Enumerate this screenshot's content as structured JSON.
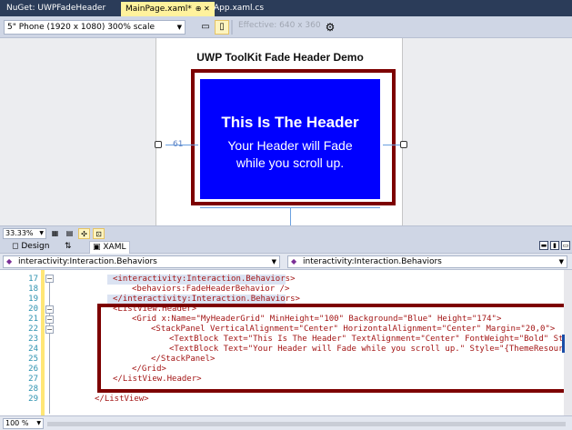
{
  "tabs": [
    {
      "label": "NuGet: UWPFadeHeader"
    },
    {
      "label": "MainPage.xaml*",
      "icons": "⊕ ✕"
    },
    {
      "label": "App.xaml.cs"
    }
  ],
  "design_toolbar": {
    "device": "5\" Phone (1920 x 1080) 300% scale",
    "effective": "Effective: 640 x 360",
    "icons": [
      "monitor-icon",
      "portrait-icon",
      "landscape-icon",
      "gear-icon"
    ]
  },
  "designer": {
    "page_title": "UWP ToolKit Fade Header Demo",
    "header_title": "This Is The Header",
    "header_subtitle_1": "Your Header will Fade",
    "header_subtitle_2": "while you scroll up.",
    "margin_left": "61",
    "colors": {
      "header_bg": "#0000ff",
      "annotation": "#7d0000"
    }
  },
  "zoom_bar": {
    "zoom": "33.33%",
    "icons": [
      "grid-icon",
      "grid-snap-icon",
      "artboard-icon",
      "snap-icon"
    ]
  },
  "split_tabs": {
    "design": "Design",
    "swap": "⇅",
    "xaml": "XAML"
  },
  "nav": {
    "left": "interactivity:Interaction.Behaviors",
    "right": "interactivity:Interaction.Behaviors"
  },
  "code": {
    "line_numbers": [
      "17",
      "18",
      "19",
      "20",
      "21",
      "22",
      "23",
      "24",
      "25",
      "26",
      "27",
      "28",
      "29"
    ],
    "top_partial": "",
    "lines": [
      "<interactivity:Interaction.Behaviors>",
      "<behaviors:FadeHeaderBehavior />",
      "</interactivity:Interaction.Behaviors>",
      "<ListView.Header>",
      "<Grid x:Name=\"MyHeaderGrid\" MinHeight=\"100\" Background=\"Blue\" Height=\"174\">",
      "<StackPanel VerticalAlignment=\"Center\" HorizontalAlignment=\"Center\" Margin=\"20,0\">",
      "<TextBlock Text=\"This Is The Header\" TextAlignment=\"Center\" FontWeight=\"Bold\" Styl",
      "<TextBlock Text=\"Your Header will Fade while you scroll up.\" Style=\"{ThemeResource",
      "</StackPanel>",
      "</Grid>",
      "</ListView.Header>",
      "",
      "</ListView>"
    ]
  },
  "status": {
    "zoom": "100 %"
  }
}
